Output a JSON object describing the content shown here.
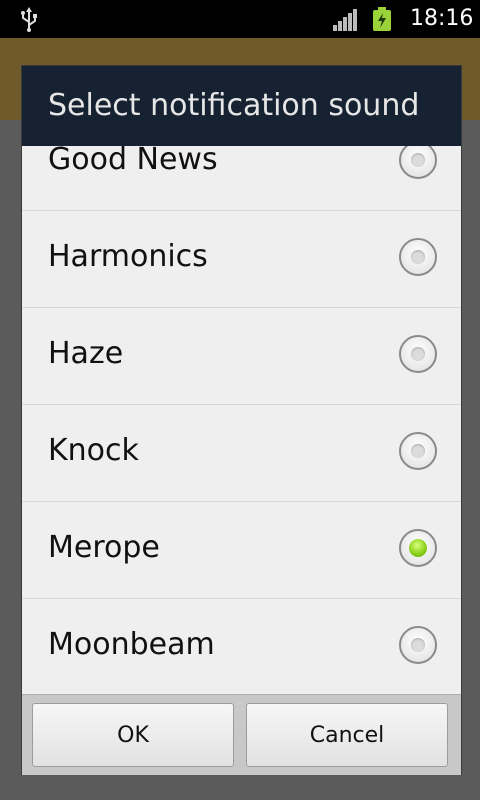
{
  "status_bar": {
    "time": "18:16",
    "icons": [
      "usb-icon",
      "signal-icon",
      "battery-charging-icon"
    ]
  },
  "dialog": {
    "title": "Select notification sound",
    "options": [
      {
        "label": "Good News",
        "selected": false
      },
      {
        "label": "Harmonics",
        "selected": false
      },
      {
        "label": "Haze",
        "selected": false
      },
      {
        "label": "Knock",
        "selected": false
      },
      {
        "label": "Merope",
        "selected": true
      },
      {
        "label": "Moonbeam",
        "selected": false
      }
    ],
    "ok_label": "OK",
    "cancel_label": "Cancel"
  },
  "colors": {
    "title_bar": "#162232",
    "radio_selected": "#8ed21c",
    "app_bar": "#6e5a2a"
  }
}
